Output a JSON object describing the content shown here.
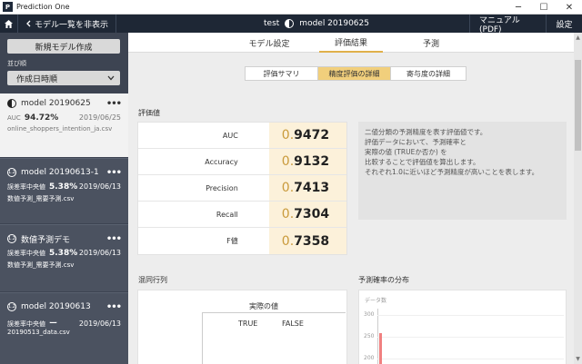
{
  "window": {
    "app_logo": "P",
    "app_title": "Prediction One",
    "controls": {
      "minimize": "─",
      "maximize": "☐",
      "close": "✕"
    }
  },
  "topbar": {
    "toggle_label": "モデル一覧を非表示",
    "project": "test",
    "model": "model 20190625",
    "manual": "マニュアル (PDF)",
    "settings": "設定"
  },
  "sidebar": {
    "new_model_button": "新規モデル作成",
    "sort_label": "並び順",
    "sort_value": "作成日時順",
    "models": [
      {
        "name": "model 20190625",
        "icon": "half-circle-icon",
        "metric_label": "AUC",
        "metric_value": "94.72%",
        "date": "2019/06/25",
        "file": "online_shoppers_intention_ja.csv",
        "dots": "•••"
      },
      {
        "name": "model 20190613-1",
        "icon": "number-icon",
        "icon_text": "1.2",
        "metric_label": "誤差率中央値",
        "metric_value": "5.38%",
        "date": "2019/06/13",
        "file": "数値予測_需要予測.csv",
        "dots": "•••"
      },
      {
        "name": "数値予測デモ",
        "icon": "number-icon",
        "icon_text": "1.2",
        "metric_label": "誤差率中央値",
        "metric_value": "5.38%",
        "date": "2019/06/13",
        "file": "数値予測_需要予測.csv",
        "dots": "•••"
      },
      {
        "name": "model 20190613",
        "icon": "number-icon",
        "icon_text": "1.2",
        "metric_label": "誤差率中央値",
        "metric_value": "ー",
        "date": "2019/06/13",
        "file": "20190513_data.csv",
        "dots": "•••"
      }
    ]
  },
  "tabs": [
    {
      "label": "モデル設定",
      "active": false
    },
    {
      "label": "評価結果",
      "active": true
    },
    {
      "label": "予測",
      "active": false
    }
  ],
  "subtabs": [
    {
      "label": "評価サマリ",
      "active": false
    },
    {
      "label": "精度評価の詳細",
      "active": true
    },
    {
      "label": "寄与度の詳細",
      "active": false
    }
  ],
  "evaluation": {
    "title": "評価値",
    "metrics": [
      {
        "label": "AUC",
        "int": "0.",
        "dec": "9472"
      },
      {
        "label": "Accuracy",
        "int": "0.",
        "dec": "9132"
      },
      {
        "label": "Precision",
        "int": "0.",
        "dec": "7413"
      },
      {
        "label": "Recall",
        "int": "0.",
        "dec": "7304"
      },
      {
        "label": "F値",
        "int": "0.",
        "dec": "7358"
      }
    ],
    "description": [
      "二値分類の予測精度を表す評価値です。",
      "評価データにおいて、予測確率と",
      "実際の値 (TRUEか否か) を",
      "比較することで評価値を算出します。",
      "それぞれ1.0に近いほど予測精度が高いことを表します。"
    ]
  },
  "confusion": {
    "title": "混同行列",
    "header": "実際の値",
    "col_true": "TRUE",
    "col_false": "FALSE"
  },
  "histogram": {
    "title": "予測確率の分布",
    "ylabel": "データ数",
    "ticks": [
      "300",
      "250",
      "200"
    ],
    "bar_color": "#f08080"
  },
  "colors": {
    "accent": "#e0b04a",
    "subtab_active": "#f1cf7c",
    "value_bg": "#fcf1da",
    "sidebar_bg": "#3d4452",
    "topbar_bg": "#1e2735"
  }
}
